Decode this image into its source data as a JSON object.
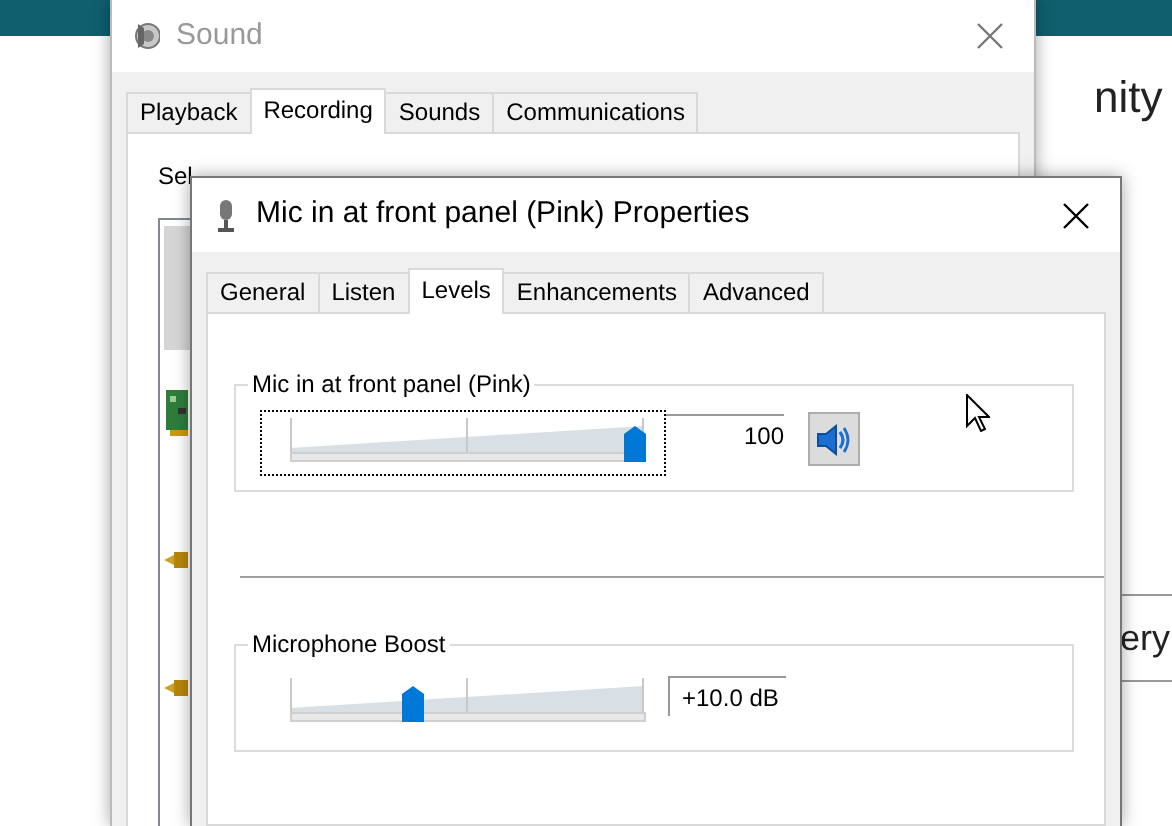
{
  "background": {
    "heading_fragment": "nity",
    "button_fragment": "ery"
  },
  "sound_window": {
    "title": "Sound",
    "tabs": [
      {
        "label": "Playback",
        "selected": false
      },
      {
        "label": "Recording",
        "selected": true
      },
      {
        "label": "Sounds",
        "selected": false
      },
      {
        "label": "Communications",
        "selected": false
      }
    ],
    "instruction": "Sel"
  },
  "properties_window": {
    "title": "Mic in at front panel (Pink) Properties",
    "tabs": [
      {
        "label": "General",
        "selected": false
      },
      {
        "label": "Listen",
        "selected": false
      },
      {
        "label": "Levels",
        "selected": true
      },
      {
        "label": "Enhancements",
        "selected": false
      },
      {
        "label": "Advanced",
        "selected": false
      }
    ],
    "groups": [
      {
        "kind": "volume",
        "label": "Mic in at front panel (Pink)",
        "level": 1,
        "reading": "100",
        "focused": true,
        "muted": false
      },
      {
        "kind": "boost",
        "label": "Microphone Boost",
        "level": 0.333,
        "reading": "+10.0 dB",
        "focused": false
      }
    ]
  }
}
